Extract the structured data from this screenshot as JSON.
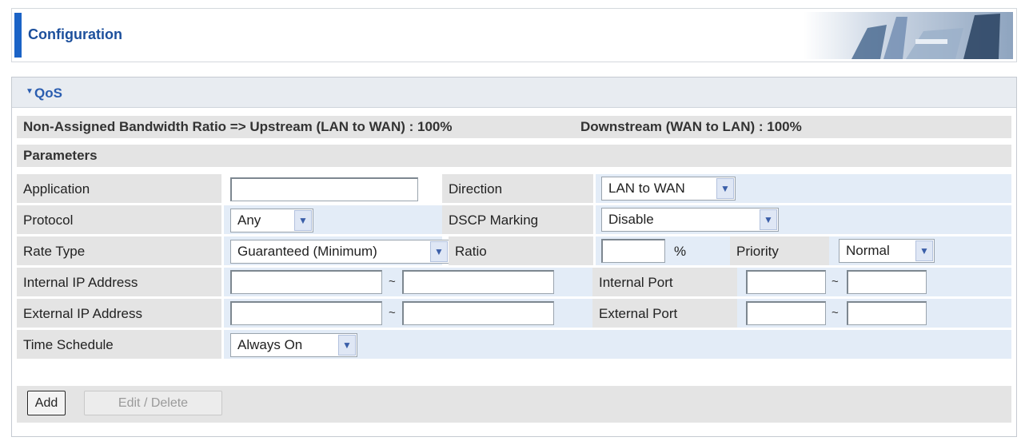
{
  "header": {
    "title": "Configuration"
  },
  "qos": {
    "title": "QoS",
    "info_left": "Non-Assigned Bandwidth Ratio => Upstream (LAN to WAN) : 100%",
    "info_right": "Downstream (WAN to LAN) : 100%",
    "parameters_label": "Parameters"
  },
  "form": {
    "application_label": "Application",
    "application_value": "",
    "direction_label": "Direction",
    "direction_value": "LAN to WAN",
    "protocol_label": "Protocol",
    "protocol_value": "Any",
    "dscp_label": "DSCP Marking",
    "dscp_value": "Disable",
    "rate_type_label": "Rate Type",
    "rate_type_value": "Guaranteed (Minimum)",
    "ratio_label": "Ratio",
    "ratio_value": "",
    "ratio_unit": "%",
    "priority_label": "Priority",
    "priority_value": "Normal",
    "internal_ip_label": "Internal IP Address",
    "internal_port_label": "Internal Port",
    "external_ip_label": "External IP Address",
    "external_port_label": "External Port",
    "range_separator": "~",
    "time_schedule_label": "Time Schedule",
    "time_schedule_value": "Always On"
  },
  "buttons": {
    "add": "Add",
    "edit_delete": "Edit / Delete"
  },
  "colors": {
    "accent_blue": "#1b63c6",
    "title_blue": "#2a5db0",
    "label_gray": "#e4e4e4",
    "field_blue": "#e3ecf7"
  },
  "icons": {
    "collapse": "triangle-down-icon",
    "dropdown": "chevron-down-icon"
  }
}
